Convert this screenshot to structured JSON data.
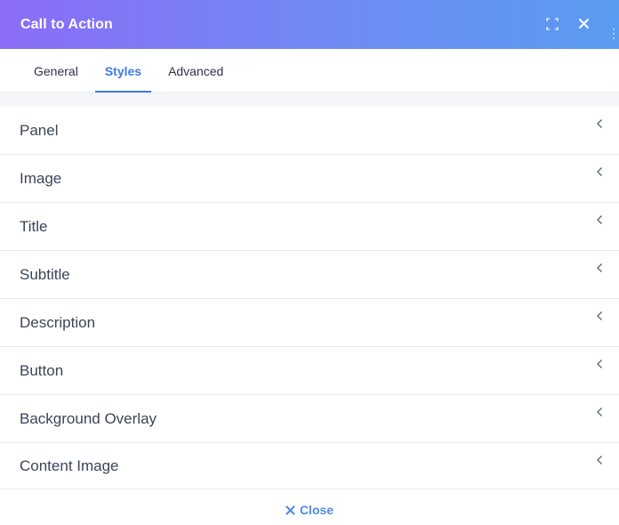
{
  "header": {
    "title": "Call to Action",
    "expand_icon": "expand-icon",
    "close_icon": "close-icon"
  },
  "tabs": [
    {
      "label": "General",
      "active": false
    },
    {
      "label": "Styles",
      "active": true
    },
    {
      "label": "Advanced",
      "active": false
    }
  ],
  "sections": [
    {
      "label": "Panel"
    },
    {
      "label": "Image"
    },
    {
      "label": "Title"
    },
    {
      "label": "Subtitle"
    },
    {
      "label": "Description"
    },
    {
      "label": "Button"
    },
    {
      "label": "Background Overlay"
    },
    {
      "label": "Content Image"
    }
  ],
  "footer": {
    "close_label": "Close"
  },
  "colors": {
    "accent": "#3c7be9",
    "header_gradient_start": "#8b6cf6",
    "header_gradient_end": "#5a9cf2"
  }
}
